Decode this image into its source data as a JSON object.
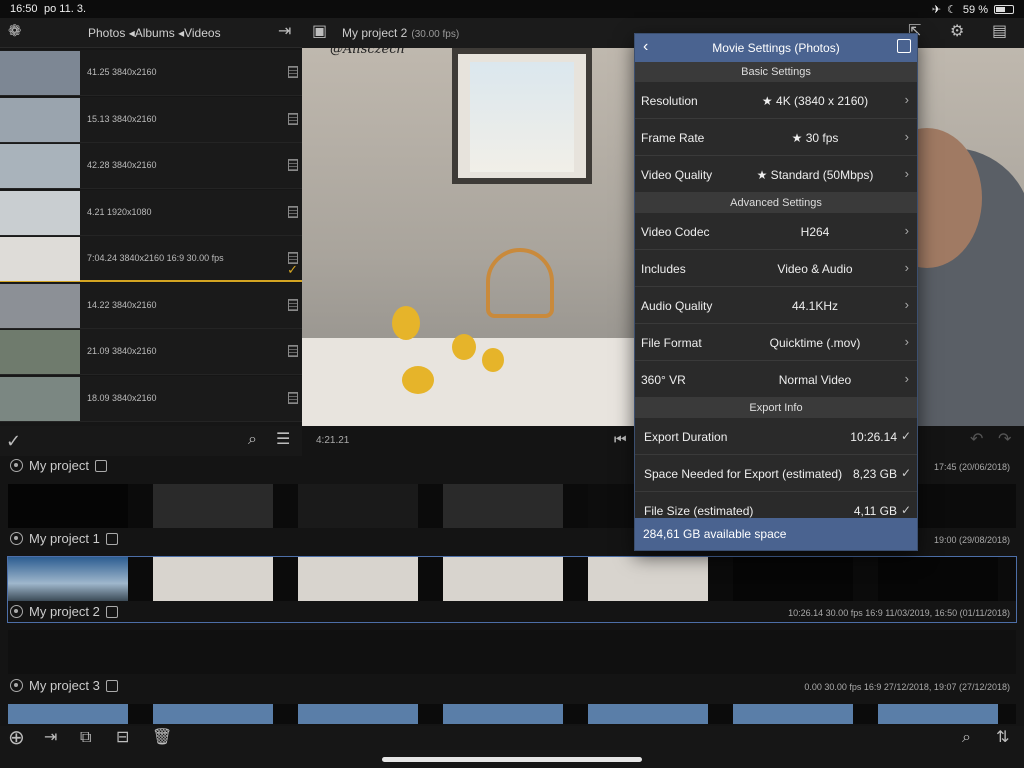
{
  "status": {
    "time": "16:50",
    "date": "po 11. 3.",
    "battery": "59 %",
    "battery_level": 0.59
  },
  "browser": {
    "tabs": "Photos ◂Albums ◂Videos",
    "clips": [
      {
        "meta": "41.25  3840x2160",
        "color": "#7d8794"
      },
      {
        "meta": "15.13  3840x2160",
        "color": "#9aa4ae"
      },
      {
        "meta": "42.28  3840x2160",
        "color": "#a9b3bb"
      },
      {
        "meta": "4.21  1920x1080",
        "color": "#c9ced1"
      },
      {
        "meta": "7:04.24  3840x2160  16:9  30.00 fps",
        "color": "#dedcd8",
        "selected": true
      },
      {
        "meta": "14.22  3840x2160",
        "color": "#8c9096"
      },
      {
        "meta": "21.09  3840x2160",
        "color": "#6f7b6d"
      },
      {
        "meta": "18.09  3840x2160",
        "color": "#7b8782"
      }
    ]
  },
  "preview": {
    "project": "My project 2",
    "fps": "(30.00 fps)",
    "watermark": "@Alisczech",
    "timecode": "4:21.21"
  },
  "timeline": {
    "projects": [
      {
        "name": "My project",
        "info": "17:45  (20/06/2018)"
      },
      {
        "name": "My project 1",
        "info": "19:00  (29/08/2018)"
      },
      {
        "name": "My project 2",
        "info": "10:26.14   30.00 fps   16:9   11/03/2019, 16:50   (01/11/2018)"
      },
      {
        "name": "My project 3",
        "info": "0.00   30.00 fps   16:9   27/12/2018, 19:07   (27/12/2018)"
      }
    ]
  },
  "popover": {
    "title": "Movie Settings (Photos)",
    "basic_header": "Basic Settings",
    "advanced_header": "Advanced Settings",
    "export_header": "Export Info",
    "basic": [
      {
        "label": "Resolution",
        "value": "★ 4K (3840 x 2160)"
      },
      {
        "label": "Frame Rate",
        "value": "★ 30 fps"
      },
      {
        "label": "Video Quality",
        "value": "★ Standard (50Mbps)"
      }
    ],
    "advanced": [
      {
        "label": "Video Codec",
        "value": "H264"
      },
      {
        "label": "Includes",
        "value": "Video & Audio"
      },
      {
        "label": "Audio Quality",
        "value": "44.1KHz"
      },
      {
        "label": "File Format",
        "value": "Quicktime (.mov)"
      },
      {
        "label": "360° VR",
        "value": "Normal Video"
      }
    ],
    "export": [
      {
        "label": "Export Duration",
        "value": "10:26.14"
      },
      {
        "label": "Space Needed for Export (estimated)",
        "value": "8,23 GB"
      },
      {
        "label": "File Size (estimated)",
        "value": "4,11 GB"
      }
    ],
    "footer": "284,61 GB available space"
  },
  "colors": {
    "accent": "#4a6390",
    "selection": "#d4a522"
  }
}
